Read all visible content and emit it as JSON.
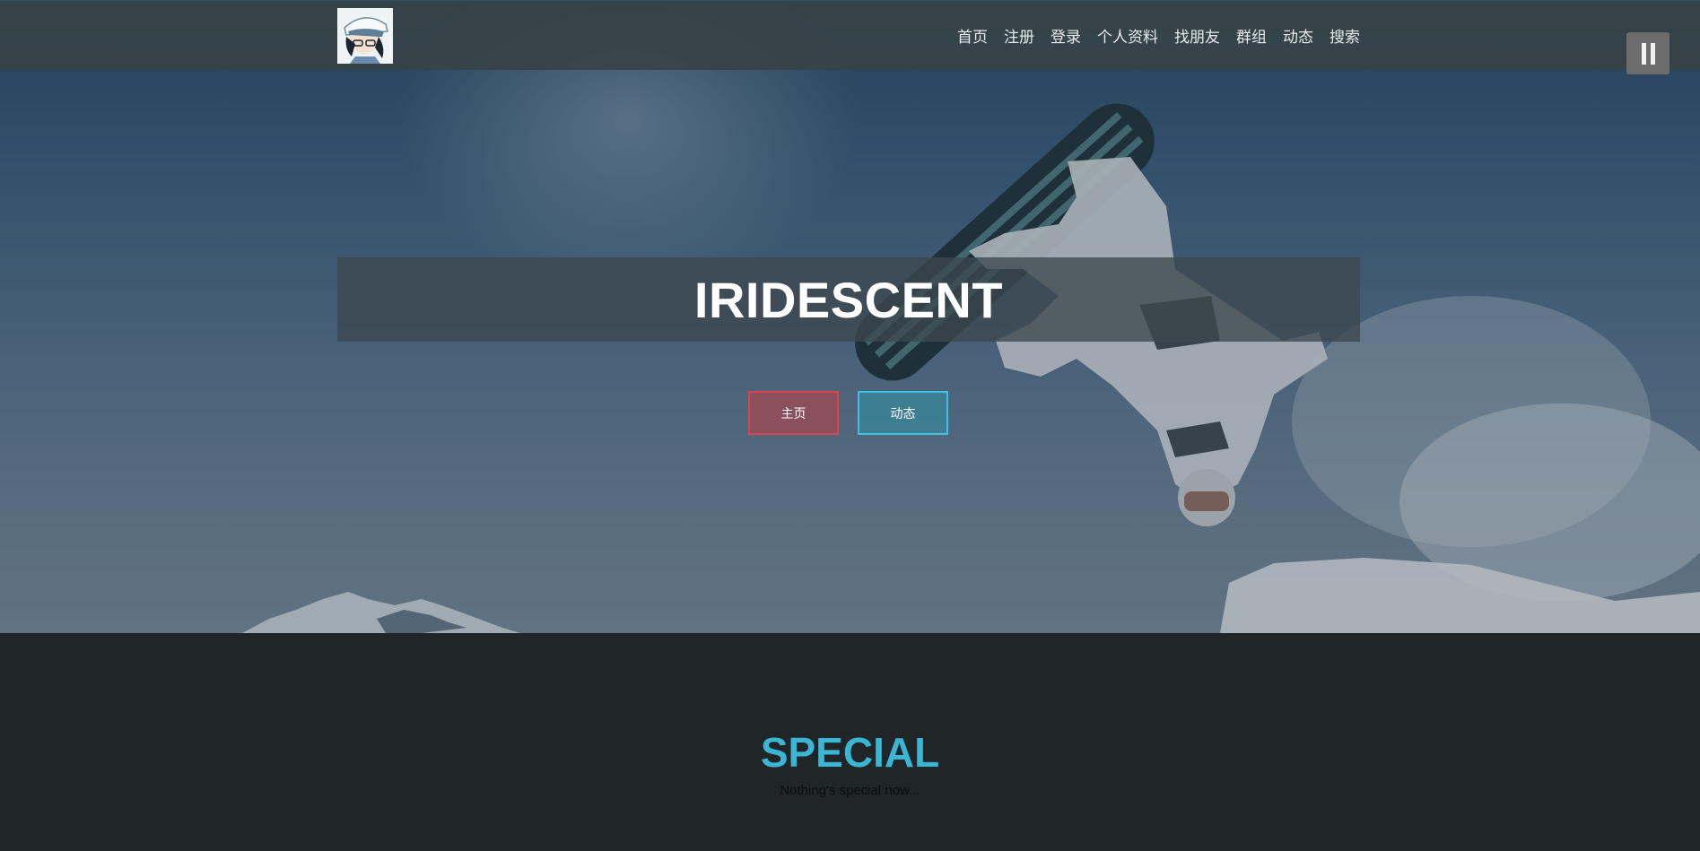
{
  "navbar": {
    "logo_icon": "anime-avatar-icon",
    "items": [
      {
        "label": "首页"
      },
      {
        "label": "注册"
      },
      {
        "label": "登录"
      },
      {
        "label": "个人资料"
      },
      {
        "label": "找朋友"
      },
      {
        "label": "群组"
      },
      {
        "label": "动态"
      },
      {
        "label": "搜索"
      }
    ]
  },
  "music_control": {
    "icon": "pause-icon"
  },
  "hero": {
    "title": "IRIDESCENT",
    "buttons": {
      "home_label": "主页",
      "feed_label": "动态"
    }
  },
  "special": {
    "title": "SPECIAL",
    "subtitle": "Nothing's special now..."
  },
  "colors": {
    "accent": "#3cb5d4",
    "home_button_border": "#d9464a",
    "feed_button_border": "#3fc0e0",
    "section_bg": "#202628"
  }
}
